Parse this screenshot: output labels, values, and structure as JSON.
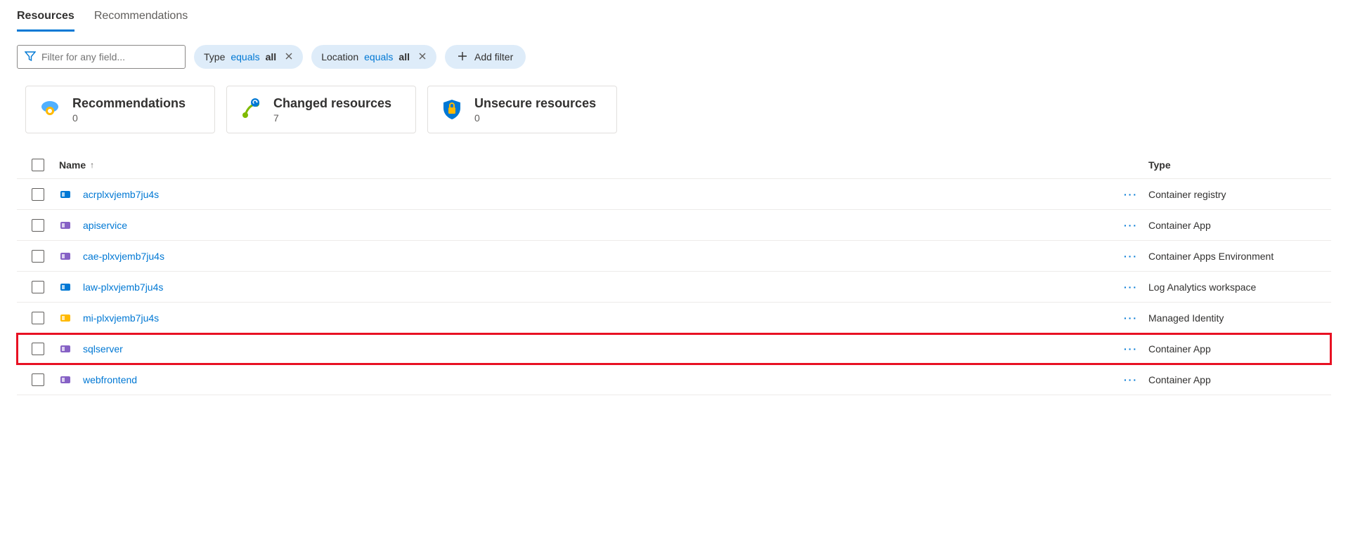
{
  "tabs": [
    {
      "label": "Resources",
      "active": true
    },
    {
      "label": "Recommendations",
      "active": false
    }
  ],
  "filterInput": {
    "placeholder": "Filter for any field..."
  },
  "filterPills": [
    {
      "field": "Type",
      "op": "equals",
      "value": "all"
    },
    {
      "field": "Location",
      "op": "equals",
      "value": "all"
    }
  ],
  "addFilterLabel": "Add filter",
  "cards": [
    {
      "title": "Recommendations",
      "count": "0",
      "icon": "recommendation"
    },
    {
      "title": "Changed resources",
      "count": "7",
      "icon": "changed"
    },
    {
      "title": "Unsecure resources",
      "count": "0",
      "icon": "unsecure"
    }
  ],
  "columns": {
    "name": "Name",
    "type": "Type"
  },
  "rows": [
    {
      "name": "acrplxvjemb7ju4s",
      "type": "Container registry",
      "iconColor": "#0078d4",
      "highlight": false
    },
    {
      "name": "apiservice",
      "type": "Container App",
      "iconColor": "#8661c5",
      "highlight": false
    },
    {
      "name": "cae-plxvjemb7ju4s",
      "type": "Container Apps Environment",
      "iconColor": "#8661c5",
      "highlight": false
    },
    {
      "name": "law-plxvjemb7ju4s",
      "type": "Log Analytics workspace",
      "iconColor": "#0078d4",
      "highlight": false
    },
    {
      "name": "mi-plxvjemb7ju4s",
      "type": "Managed Identity",
      "iconColor": "#ffb900",
      "highlight": false
    },
    {
      "name": "sqlserver",
      "type": "Container App",
      "iconColor": "#8661c5",
      "highlight": true
    },
    {
      "name": "webfrontend",
      "type": "Container App",
      "iconColor": "#8661c5",
      "highlight": false
    }
  ]
}
